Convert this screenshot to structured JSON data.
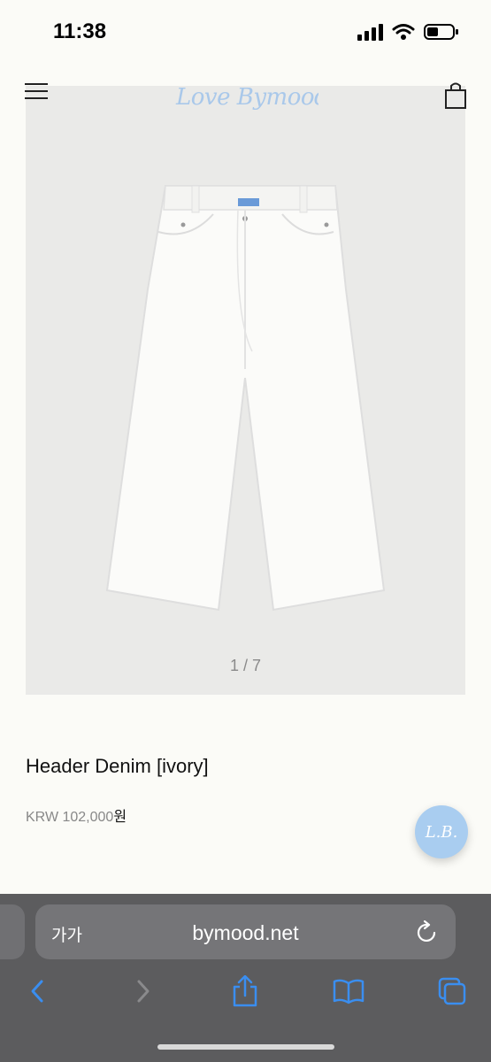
{
  "status": {
    "time": "11:38"
  },
  "brand": {
    "logo_text": "Love Bymood",
    "chat_logo_text": "L.B."
  },
  "product": {
    "image_counter": "1 / 7",
    "title": "Header Denim [ivory]",
    "price_prefix": "KRW 102,000",
    "price_suffix": "원"
  },
  "browser": {
    "text_size_label": "가가",
    "url": "bymood.net"
  },
  "colors": {
    "accent": "#a9cdf0",
    "toolbar_blue": "#3a8ef0"
  }
}
